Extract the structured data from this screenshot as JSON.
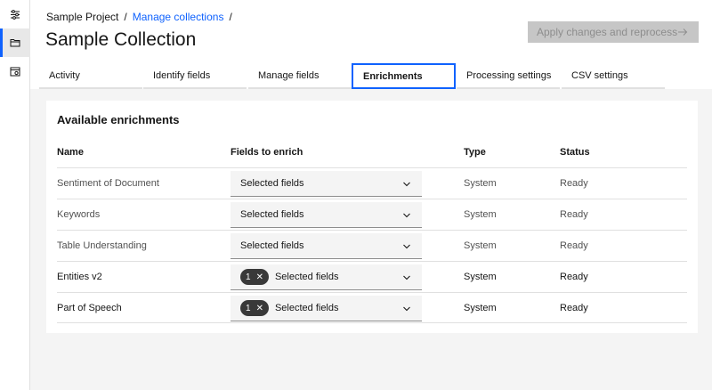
{
  "breadcrumb": {
    "project": "Sample Project",
    "separator": "/",
    "collections_link": "Manage collections"
  },
  "page_title": "Sample Collection",
  "apply_button": {
    "label": "Apply changes and reprocess",
    "enabled": false
  },
  "sidebar": {
    "items": [
      {
        "icon": "settings-sliders-icon",
        "active": false
      },
      {
        "icon": "folder-icon",
        "active": true
      },
      {
        "icon": "calendar-settings-icon",
        "active": false
      }
    ]
  },
  "tabs": [
    {
      "label": "Activity",
      "active": false
    },
    {
      "label": "Identify fields",
      "active": false
    },
    {
      "label": "Manage fields",
      "active": false
    },
    {
      "label": "Enrichments",
      "active": true
    },
    {
      "label": "Processing settings",
      "active": false
    },
    {
      "label": "CSV settings",
      "active": false
    }
  ],
  "panel": {
    "title": "Available enrichments",
    "columns": {
      "name": "Name",
      "fields": "Fields to enrich",
      "type": "Type",
      "status": "Status"
    },
    "rows": [
      {
        "name": "Sentiment of Document",
        "selected_count": null,
        "fields_label": "Selected fields",
        "type": "System",
        "status": "Ready"
      },
      {
        "name": "Keywords",
        "selected_count": null,
        "fields_label": "Selected fields",
        "type": "System",
        "status": "Ready"
      },
      {
        "name": "Table Understanding",
        "selected_count": null,
        "fields_label": "Selected fields",
        "type": "System",
        "status": "Ready"
      },
      {
        "name": "Entities v2",
        "selected_count": "1",
        "fields_label": "Selected fields",
        "type": "System",
        "status": "Ready"
      },
      {
        "name": "Part of Speech",
        "selected_count": "1",
        "fields_label": "Selected fields",
        "type": "System",
        "status": "Ready"
      }
    ]
  },
  "colors": {
    "accent": "#0f62fe",
    "tag_bg": "#393939",
    "disabled_bg": "#c6c6c6"
  }
}
